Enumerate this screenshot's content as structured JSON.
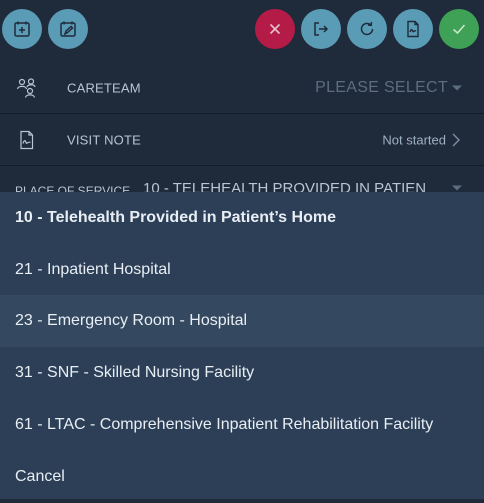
{
  "toolbar": {
    "left_buttons": [
      {
        "icon": "calendar-add-icon",
        "color": "#5a9bb6"
      },
      {
        "icon": "calendar-edit-icon",
        "color": "#5a9bb6"
      }
    ],
    "right_buttons": [
      {
        "icon": "close-icon",
        "color": "#b41b47"
      },
      {
        "icon": "export-icon",
        "color": "#5a9bb6"
      },
      {
        "icon": "refresh-icon",
        "color": "#5a9bb6"
      },
      {
        "icon": "document-sign-icon",
        "color": "#5a9bb6"
      },
      {
        "icon": "check-icon",
        "color": "#3fa155"
      }
    ]
  },
  "careteam": {
    "label": "CARETEAM",
    "placeholder": "PLEASE SELECT"
  },
  "visit_note": {
    "label": "VISIT NOTE",
    "status": "Not started"
  },
  "place_of_service": {
    "label": "PLACE OF SERVICE",
    "value": "10 - TELEHEALTH PROVIDED IN PATIEN"
  },
  "dropdown": {
    "options": [
      "10 - Telehealth Provided in Patient’s Home",
      "21 - Inpatient Hospital",
      "23 - Emergency Room - Hospital",
      "31 - SNF - Skilled Nursing Facility",
      "61 - LTAC - Comprehensive Inpatient Rehabilitation Facility",
      "Cancel"
    ],
    "selected": "10 - Telehealth Provided in Patient’s Home",
    "highlighted": "23 - Emergency Room - Hospital"
  }
}
